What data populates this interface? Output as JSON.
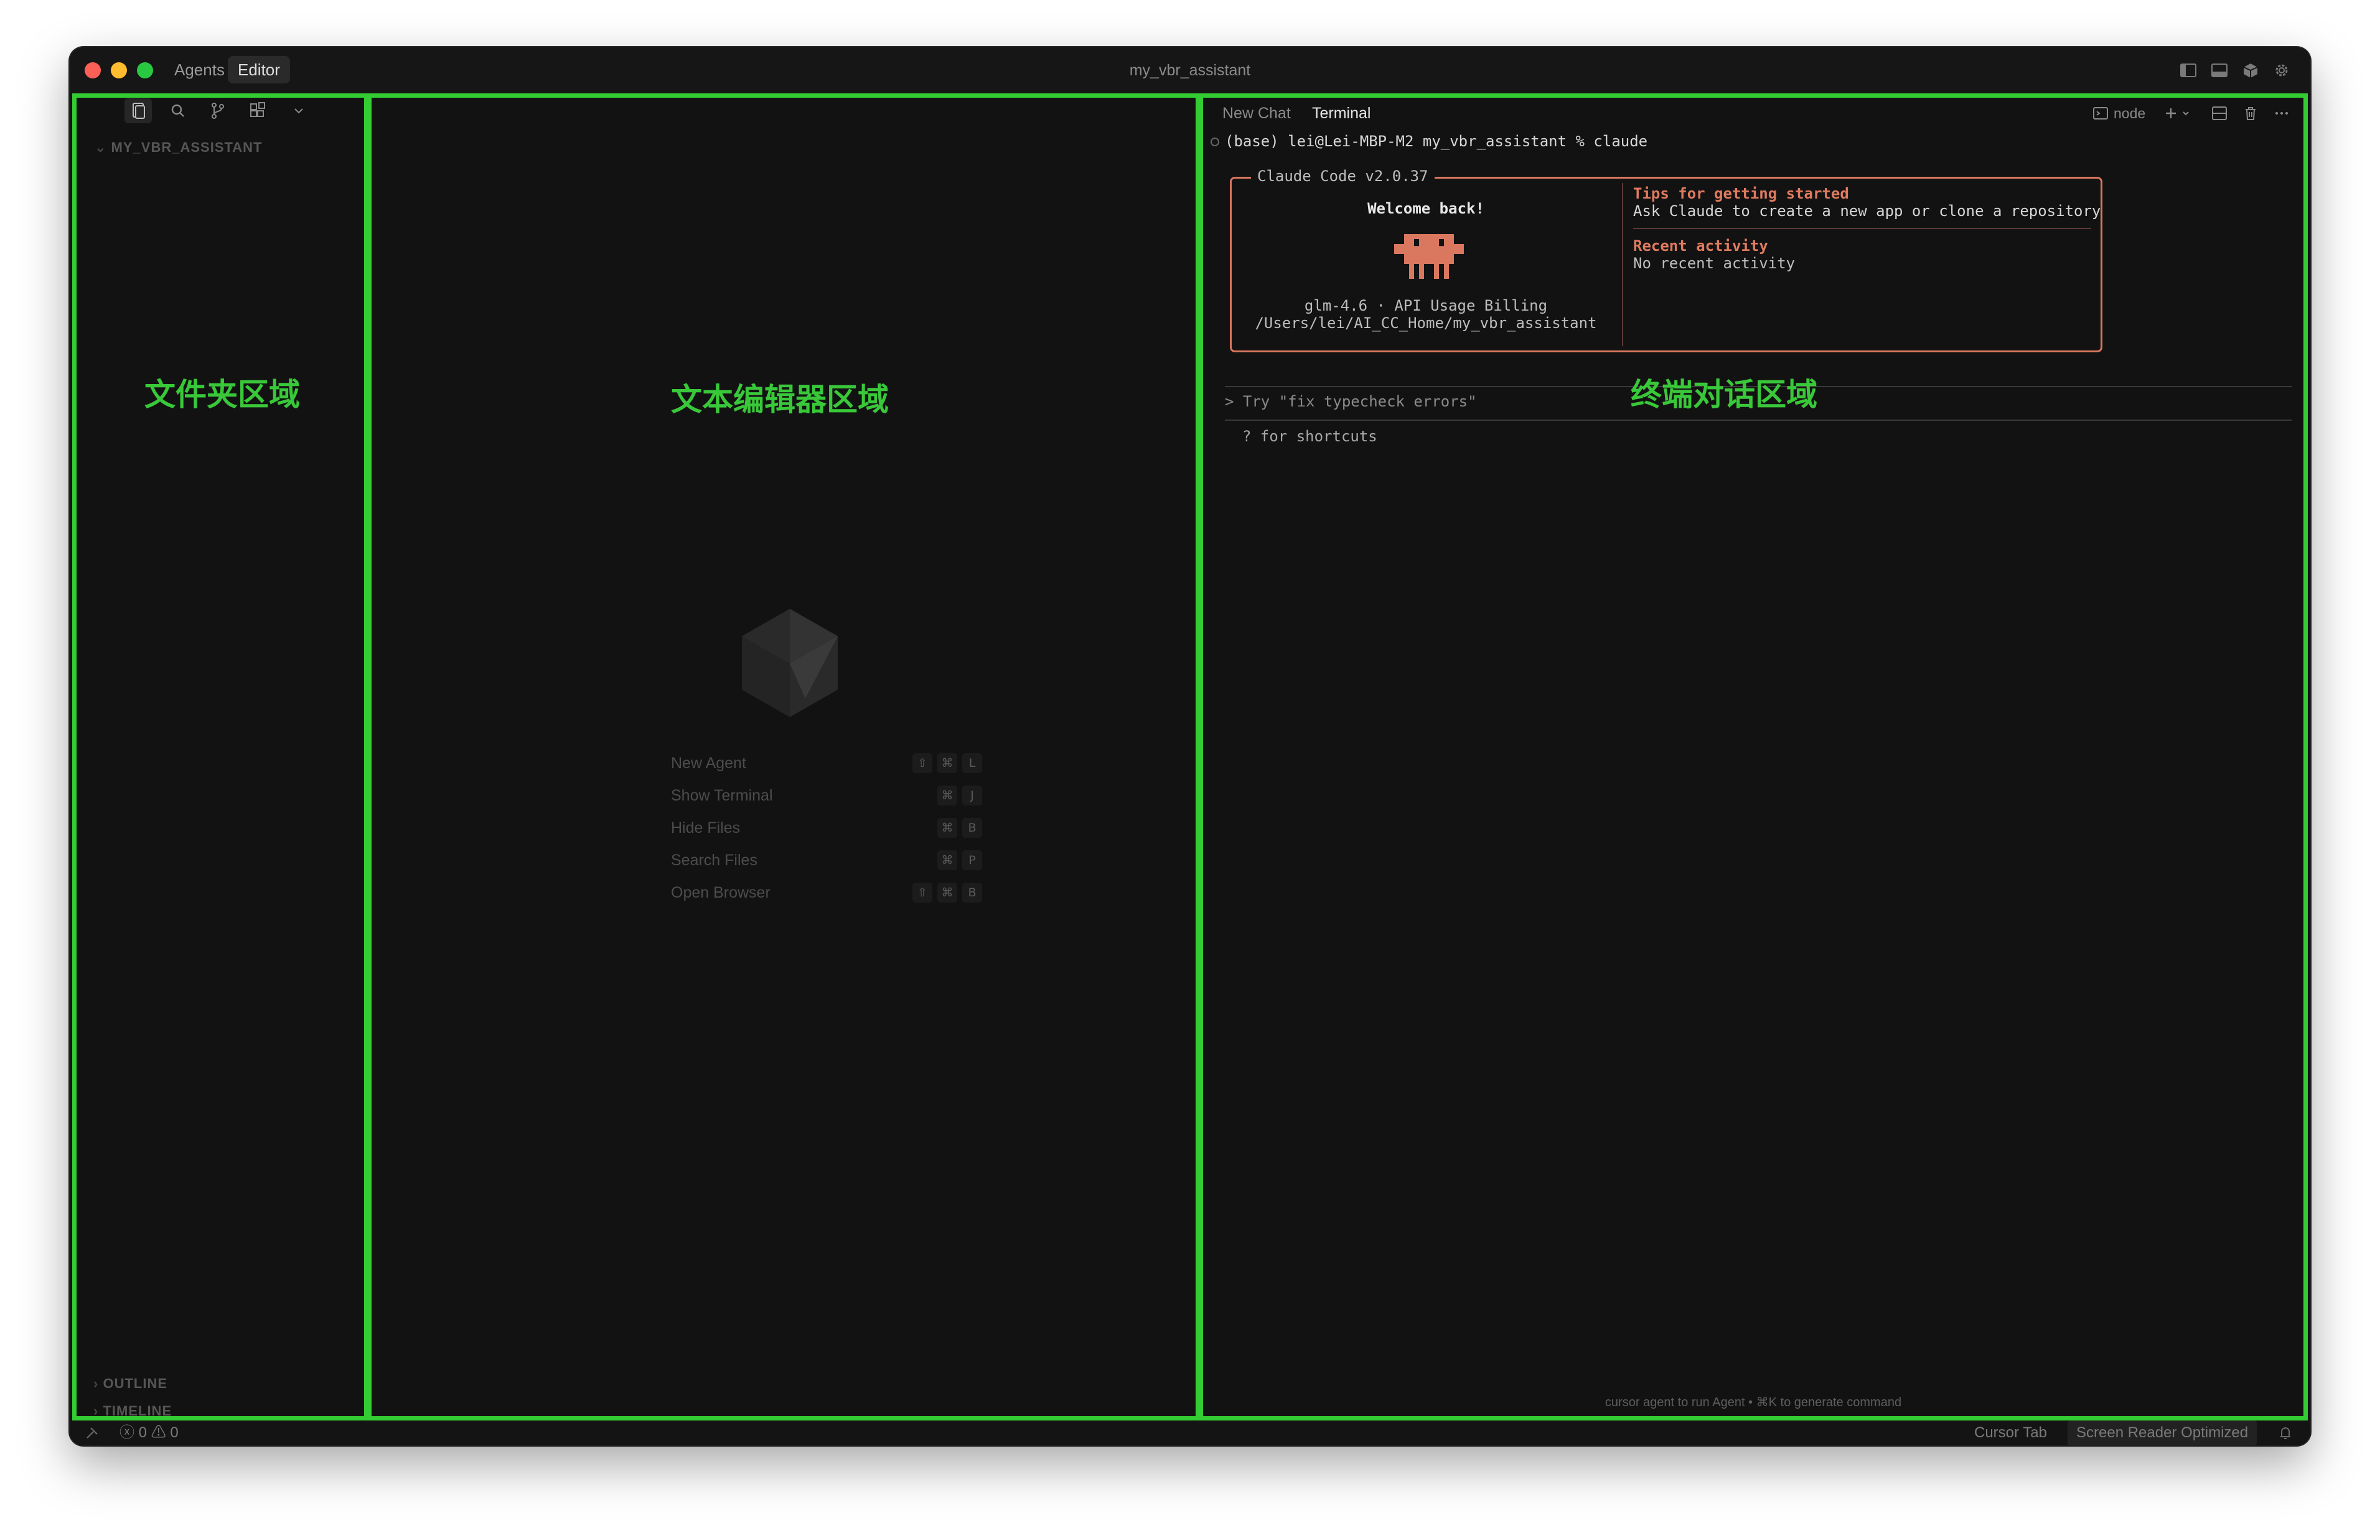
{
  "window": {
    "title": "my_vbr_assistant"
  },
  "titlebar": {
    "tabs": [
      {
        "label": "Agents"
      },
      {
        "label": "Editor",
        "active": true
      }
    ]
  },
  "regions": {
    "folder_label": "文件夹区域",
    "editor_label": "文本编辑器区域",
    "terminal_label": "终端对话区域",
    "outline_color": "#33cc33"
  },
  "sidebar": {
    "toolbar_icons": [
      "files-icon",
      "search-icon",
      "source-control-icon",
      "extensions-icon",
      "chevron-down-icon"
    ],
    "project": "MY_VBR_ASSISTANT",
    "sections": [
      "OUTLINE",
      "TIMELINE"
    ]
  },
  "editor": {
    "shortcuts": [
      {
        "label": "New Agent",
        "keys": [
          "⇧",
          "⌘",
          "L"
        ]
      },
      {
        "label": "Show Terminal",
        "keys": [
          "⌘",
          "J"
        ]
      },
      {
        "label": "Hide Files",
        "keys": [
          "⌘",
          "B"
        ]
      },
      {
        "label": "Search Files",
        "keys": [
          "⌘",
          "P"
        ]
      },
      {
        "label": "Open Browser",
        "keys": [
          "⇧",
          "⌘",
          "B"
        ]
      }
    ]
  },
  "terminal": {
    "tabs": [
      {
        "label": "New Chat"
      },
      {
        "label": "Terminal",
        "active": true
      }
    ],
    "shell_label": "node",
    "prompt": "(base) lei@Lei-MBP-M2 my_vbr_assistant % claude",
    "claude": {
      "title": "Claude Code",
      "version": "v2.0.37",
      "welcome": "Welcome back!",
      "model": "glm-4.6 · API Usage Billing",
      "path": "/Users/lei/AI_CC_Home/my_vbr_assistant",
      "tips_title": "Tips for getting started",
      "tips_text": "Ask Claude to create a new app or clone a repository",
      "recent_title": "Recent activity",
      "recent_text": "No recent activity",
      "accent": "#d9775f"
    },
    "input_placeholder": "> Try \"fix typecheck errors\"",
    "shortcuts_hint": "? for shortcuts",
    "footer_hint": "cursor agent to run Agent • ⌘K to generate command"
  },
  "status": {
    "errors": "0",
    "warnings": "0",
    "cursor_tab": "Cursor Tab",
    "screen_reader": "Screen Reader Optimized"
  }
}
